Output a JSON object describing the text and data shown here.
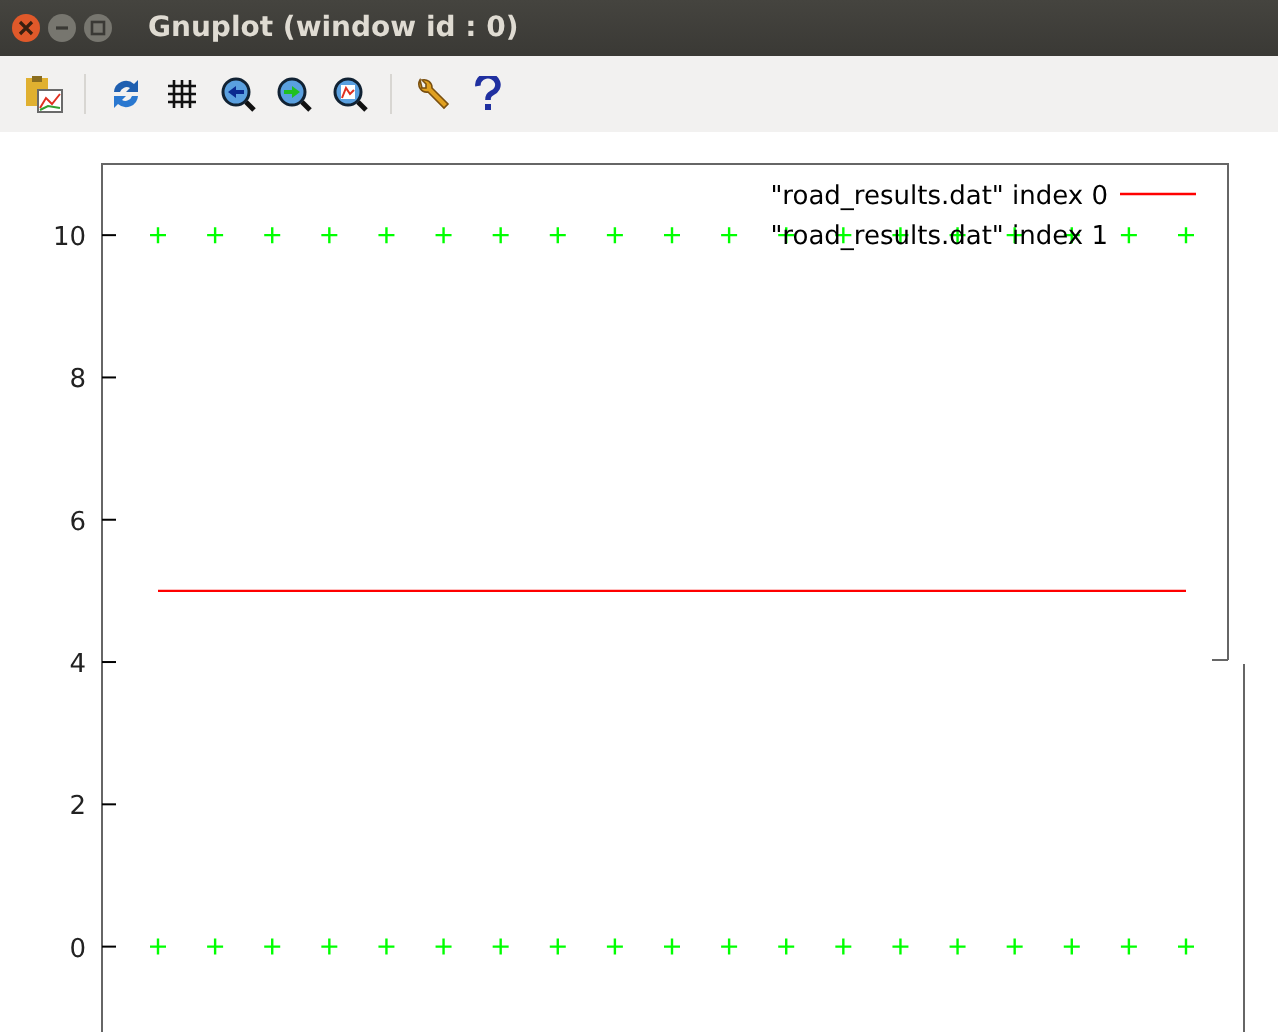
{
  "window": {
    "title": "Gnuplot (window id : 0)"
  },
  "plot": {
    "chart_data": {
      "type": "scatter",
      "categories": [
        null,
        null,
        null,
        null,
        null,
        null,
        null,
        null,
        null,
        null,
        null,
        null,
        null,
        null,
        null,
        null,
        null,
        null,
        null
      ],
      "ylim": [
        -1.2,
        11
      ],
      "yticks": [
        0,
        2,
        4,
        6,
        8,
        10
      ],
      "series": [
        {
          "name": "\"road_results.dat\" index 0",
          "color": "#ff0000",
          "type": "line",
          "values": [
            5,
            5,
            5,
            5,
            5,
            5,
            5,
            5,
            5,
            5,
            5,
            5,
            5,
            5,
            5,
            5,
            5,
            5,
            5
          ]
        },
        {
          "name": "\"road_results.dat\" index 1",
          "color": "#00ff00",
          "values": [
            10,
            10,
            10,
            10,
            10,
            10,
            10,
            10,
            10,
            10,
            10,
            10,
            10,
            10,
            10,
            10,
            10,
            10,
            10
          ]
        },
        {
          "color": "#00ff00",
          "values": [
            0,
            0,
            0,
            0,
            0,
            0,
            0,
            0,
            0,
            0,
            0,
            0,
            0,
            0,
            0,
            0,
            0,
            0,
            0
          ]
        }
      ]
    }
  }
}
